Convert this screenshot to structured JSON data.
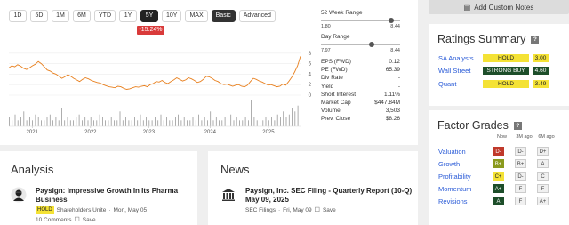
{
  "periods": [
    "1D",
    "5D",
    "1M",
    "6M",
    "YTD",
    "1Y",
    "5Y",
    "10Y",
    "MAX"
  ],
  "active_period": "5Y",
  "modes": [
    "Basic",
    "Advanced"
  ],
  "active_mode": "Basic",
  "change_badge": "-15.24%",
  "chart_data": {
    "type": "line",
    "x_ticks": [
      "2021",
      "2022",
      "2023",
      "2024",
      "2025"
    ],
    "y_ticks": [
      "8",
      "6",
      "4",
      "2",
      "0"
    ],
    "ylim": [
      0,
      10
    ],
    "series": [
      {
        "values": [
          5.2,
          5.6,
          5.4,
          5.8,
          5.5,
          5.1,
          4.9,
          5.2,
          5.6,
          5.9,
          6.4,
          6.0,
          5.4,
          4.8,
          4.6,
          4.2,
          4.0,
          3.6,
          3.2,
          3.5,
          3.9,
          3.6,
          3.2,
          2.9,
          2.6,
          3.0,
          3.3,
          3.1,
          2.8,
          2.6,
          2.4,
          2.3,
          2.0,
          1.8,
          1.6,
          1.5,
          1.4,
          1.7,
          1.6,
          1.3,
          1.1,
          1.2,
          1.4,
          1.6,
          1.5,
          1.7,
          1.8,
          1.6,
          2.0,
          2.2,
          2.6,
          2.5,
          2.8,
          2.4,
          2.2,
          2.6,
          2.9,
          3.3,
          3.0,
          2.7,
          2.9,
          3.3,
          3.1,
          2.8,
          2.4,
          2.6,
          3.0,
          3.6,
          3.5,
          3.2,
          2.8,
          2.6,
          2.2,
          2.0,
          2.1,
          1.9,
          1.7,
          1.9,
          2.0,
          1.7,
          1.6,
          1.9,
          2.6,
          3.2,
          3.0,
          2.7,
          2.5,
          2.2,
          1.9,
          2.0,
          1.8,
          1.6,
          1.7,
          2.1,
          1.9,
          2.6,
          3.4,
          4.4,
          5.6,
          7.4
        ]
      }
    ],
    "volume": [
      3,
      2,
      4,
      2,
      3,
      5,
      2,
      3,
      2,
      4,
      3,
      2,
      2,
      3,
      4,
      2,
      3,
      2,
      6,
      2,
      3,
      2,
      2,
      3,
      4,
      2,
      3,
      2,
      3,
      2,
      2,
      4,
      3,
      2,
      2,
      3,
      2,
      2,
      5,
      2,
      3,
      2,
      2,
      3,
      2,
      4,
      2,
      3,
      2,
      2,
      3,
      2,
      4,
      2,
      3,
      2,
      2,
      3,
      4,
      2,
      3,
      2,
      2,
      3,
      2,
      4,
      2,
      3,
      2,
      5,
      2,
      3,
      2,
      2,
      3,
      2,
      4,
      2,
      3,
      2,
      2,
      3,
      2,
      9,
      3,
      2,
      4,
      2,
      3,
      2,
      3,
      2,
      4,
      3,
      5,
      3,
      4,
      6,
      5,
      7
    ]
  },
  "stats": {
    "week52": {
      "label": "52 Week Range",
      "low": "1.80",
      "high": "8.44",
      "position": 0.92
    },
    "day": {
      "label": "Day Range",
      "low": "7.97",
      "high": "8.44",
      "position": 0.65
    },
    "rows": [
      {
        "label": "EPS (FWD)",
        "value": "0.12"
      },
      {
        "label": "PE (FWD)",
        "value": "65.39"
      },
      {
        "label": "Div Rate",
        "value": "-"
      },
      {
        "label": "Yield",
        "value": "-"
      },
      {
        "label": "Short Interest",
        "value": "1.11%"
      },
      {
        "label": "Market Cap",
        "value": "$447.84M"
      },
      {
        "label": "Volume",
        "value": "3,503"
      },
      {
        "label": "Prev. Close",
        "value": "$8.26"
      }
    ]
  },
  "custom_notes": "Add Custom Notes",
  "analysis": {
    "title": "Analysis",
    "article_title": "Paysign: Impressive Growth In Its Pharma Business",
    "rating": "HOLD",
    "author": "Shareholders Unite",
    "date": "Mon, May 05",
    "comments": "10 Comments",
    "save": "Save"
  },
  "news": {
    "title": "News",
    "article_title": "Paysign, Inc. SEC Filing - Quarterly Report (10-Q) May 09, 2025",
    "source": "SEC Filings",
    "date": "Fri, May 09",
    "save": "Save"
  },
  "ratings": {
    "title": "Ratings Summary",
    "help": "?",
    "rows": [
      {
        "name": "SA Analysts",
        "rating": "HOLD",
        "score": "3.00"
      },
      {
        "name": "Wall Street",
        "rating": "STRONG BUY",
        "score": "4.60"
      },
      {
        "name": "Quant",
        "rating": "HOLD",
        "score": "3.49"
      }
    ]
  },
  "factors": {
    "title": "Factor Grades",
    "help": "?",
    "headers": [
      "Now",
      "3M ago",
      "6M ago"
    ],
    "rows": [
      {
        "name": "Valuation",
        "grades": [
          "D-",
          "D-",
          "D+"
        ]
      },
      {
        "name": "Growth",
        "grades": [
          "B+",
          "B+",
          "A"
        ]
      },
      {
        "name": "Profitability",
        "grades": [
          "C+",
          "D-",
          "C"
        ]
      },
      {
        "name": "Momentum",
        "grades": [
          "A+",
          "F",
          "F"
        ]
      },
      {
        "name": "Revisions",
        "grades": [
          "A",
          "F",
          "A+"
        ]
      }
    ]
  },
  "colors": {
    "line": "#e8801f",
    "negative": "#d93a3a",
    "link": "#2a5bd7",
    "hold": "#f4e235",
    "strong_buy": "#1d4e2a"
  }
}
